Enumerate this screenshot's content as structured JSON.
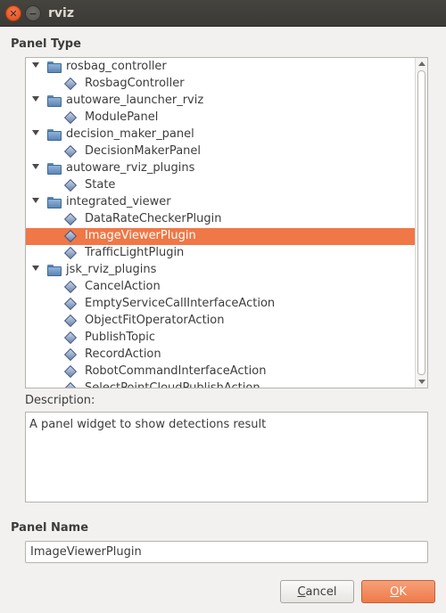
{
  "window": {
    "title": "rviz",
    "close_icon": "close-icon",
    "minimize_icon": "minimize-icon"
  },
  "panel_type_label": "Panel Type",
  "tree": {
    "rows": [
      {
        "kind": "parent",
        "label": "rosbag_controller",
        "icon": "folder-icon"
      },
      {
        "kind": "child",
        "label": "RosbagController",
        "icon": "plugin-diamond-icon"
      },
      {
        "kind": "parent",
        "label": "autoware_launcher_rviz",
        "icon": "folder-icon"
      },
      {
        "kind": "child",
        "label": "ModulePanel",
        "icon": "plugin-diamond-icon"
      },
      {
        "kind": "parent",
        "label": "decision_maker_panel",
        "icon": "folder-icon"
      },
      {
        "kind": "child",
        "label": "DecisionMakerPanel",
        "icon": "plugin-diamond-icon"
      },
      {
        "kind": "parent",
        "label": "autoware_rviz_plugins",
        "icon": "folder-icon"
      },
      {
        "kind": "child",
        "label": "State",
        "icon": "plugin-diamond-icon"
      },
      {
        "kind": "parent",
        "label": "integrated_viewer",
        "icon": "folder-icon"
      },
      {
        "kind": "child",
        "label": "DataRateCheckerPlugin",
        "icon": "plugin-diamond-icon"
      },
      {
        "kind": "child",
        "label": "ImageViewerPlugin",
        "icon": "plugin-diamond-icon",
        "selected": true
      },
      {
        "kind": "child",
        "label": "TrafficLightPlugin",
        "icon": "plugin-diamond-icon"
      },
      {
        "kind": "parent",
        "label": "jsk_rviz_plugins",
        "icon": "folder-icon"
      },
      {
        "kind": "child",
        "label": "CancelAction",
        "icon": "plugin-diamond-icon"
      },
      {
        "kind": "child",
        "label": "EmptyServiceCallInterfaceAction",
        "icon": "plugin-diamond-icon"
      },
      {
        "kind": "child",
        "label": "ObjectFitOperatorAction",
        "icon": "plugin-diamond-icon"
      },
      {
        "kind": "child",
        "label": "PublishTopic",
        "icon": "plugin-diamond-icon"
      },
      {
        "kind": "child",
        "label": "RecordAction",
        "icon": "plugin-diamond-icon"
      },
      {
        "kind": "child",
        "label": "RobotCommandInterfaceAction",
        "icon": "plugin-diamond-icon"
      },
      {
        "kind": "child",
        "label": "SelectPointCloudPublishAction",
        "icon": "plugin-diamond-icon"
      }
    ]
  },
  "description_label": "Description:",
  "description_text": "A panel widget to show detections result",
  "panel_name_label": "Panel Name",
  "panel_name_value": "ImageViewerPlugin",
  "buttons": {
    "cancel": "Cancel",
    "ok": "OK"
  },
  "colors": {
    "selection": "#f07746",
    "titlebar": "#3f3e3a",
    "ok_button": "#ef7a48"
  }
}
